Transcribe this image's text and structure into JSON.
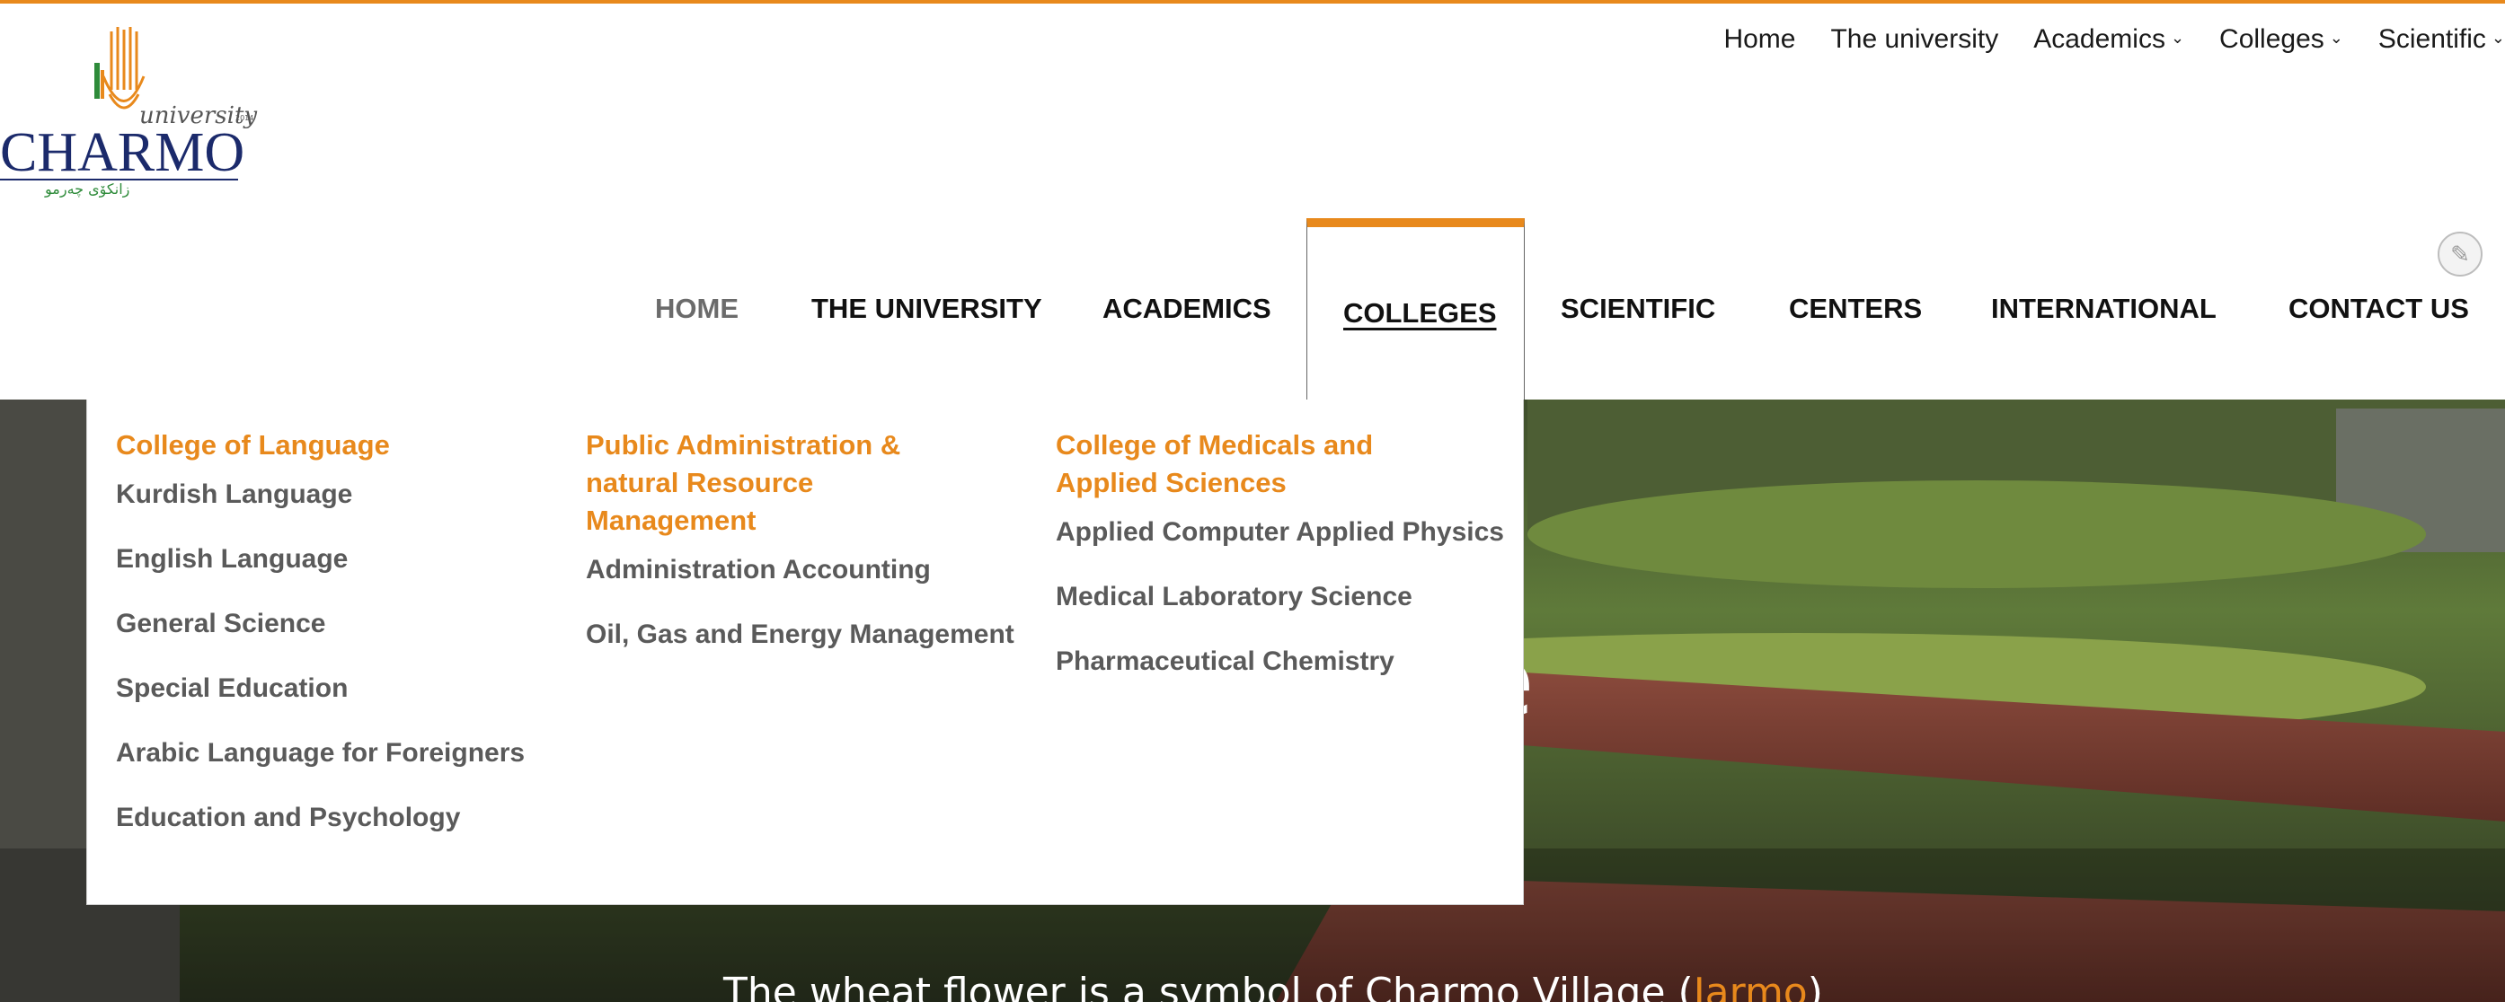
{
  "top_nav": [
    {
      "label": "Home",
      "dropdown": false
    },
    {
      "label": "The university",
      "dropdown": false
    },
    {
      "label": "Academics",
      "dropdown": true
    },
    {
      "label": "Colleges",
      "dropdown": true
    },
    {
      "label": "Scientific",
      "dropdown": true
    }
  ],
  "logo": {
    "word": "CHARMO",
    "script": "university",
    "year": "2014",
    "kurdish": "زانكۆى چەرمو"
  },
  "main_nav": [
    {
      "label": "HOME"
    },
    {
      "label": "THE UNIVERSITY"
    },
    {
      "label": "ACADEMICS"
    },
    {
      "label": "COLLEGES"
    },
    {
      "label": "SCIENTIFIC"
    },
    {
      "label": "CENTERS"
    },
    {
      "label": "INTERNATIONAL"
    },
    {
      "label": "CONTACT US"
    }
  ],
  "edit_icon": "pencil-icon",
  "dropdown": {
    "columns": [
      {
        "heading": "College of Language",
        "items": [
          "Kurdish Language",
          "English Language",
          "General Science",
          "Special Education",
          "Arabic Language for Foreigners",
          "Education and Psychology"
        ]
      },
      {
        "heading": "Public Administration & natural Resource Management",
        "items": [
          "Administration Accounting",
          "Oil, Gas and Energy Management"
        ]
      },
      {
        "heading": "College of Medicals and Applied Sciences",
        "items": [
          "Applied Computer Applied Physics",
          "Medical Laboratory Science",
          "Pharmaceutical Chemistry"
        ]
      }
    ]
  },
  "hero": {
    "title_fragment": "e",
    "caption_prefix": "The wheat flower is a symbol of Charmo Village (",
    "caption_highlight": "Jarmo",
    "caption_suffix": ")"
  },
  "colors": {
    "accent": "#e8891c",
    "logo_blue": "#1b2a6b",
    "logo_green": "#2e8b3a"
  }
}
